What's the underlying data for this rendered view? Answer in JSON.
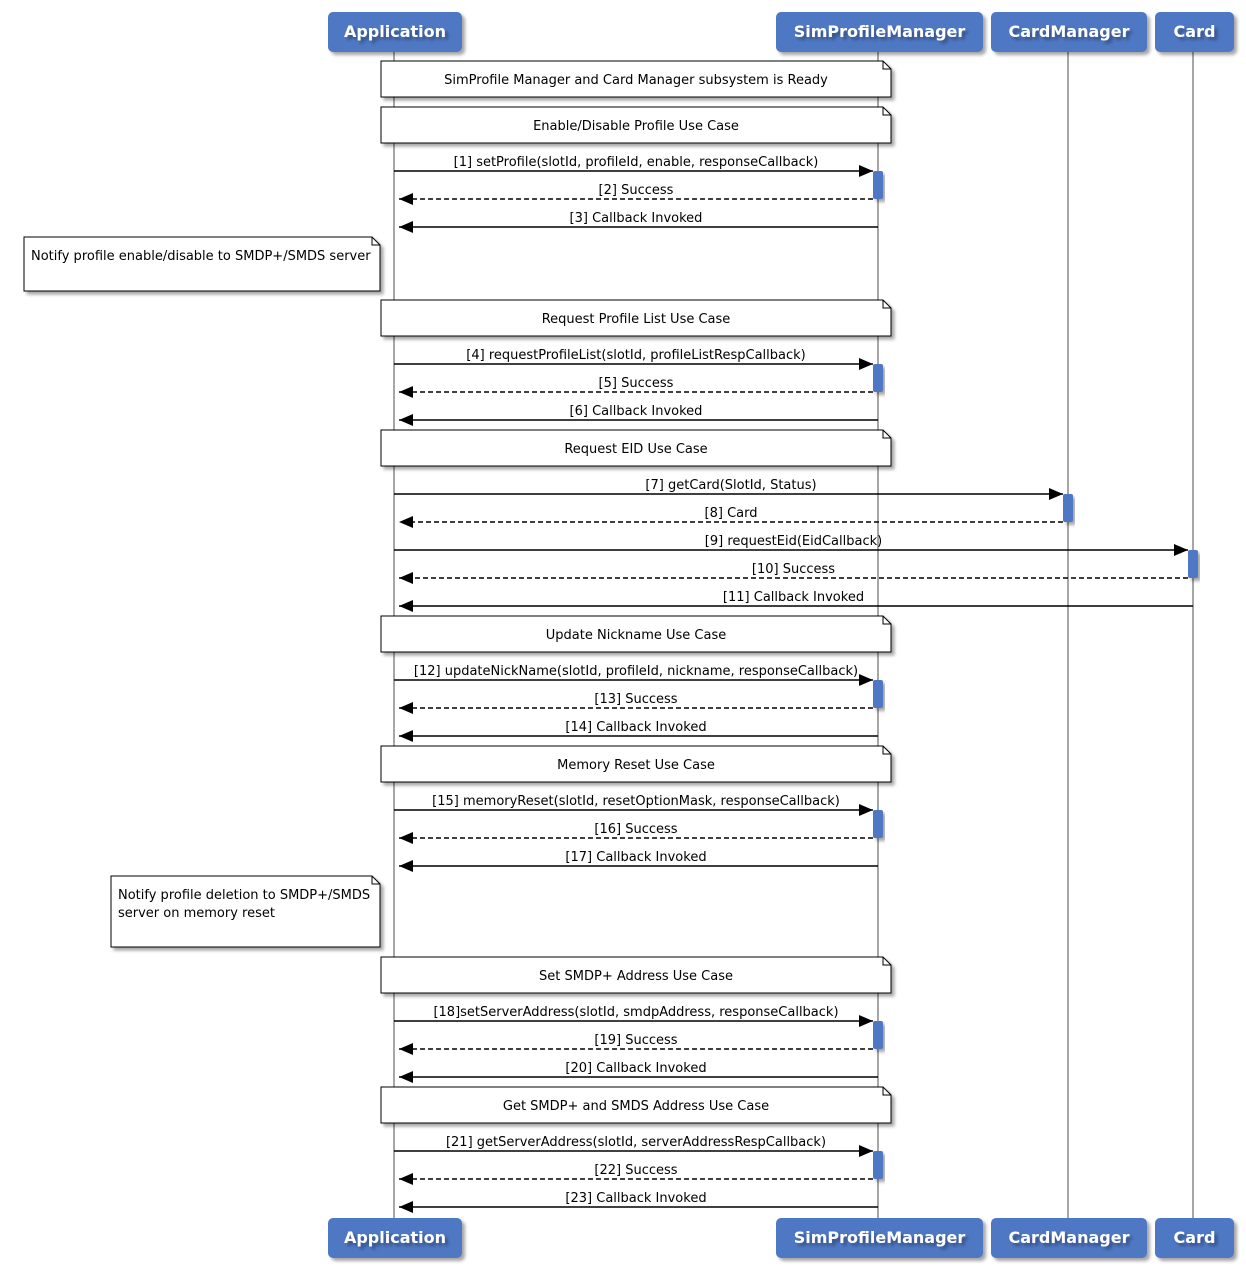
{
  "participants": [
    {
      "id": "app",
      "label": "Application"
    },
    {
      "id": "spm",
      "label": "SimProfileManager"
    },
    {
      "id": "cm",
      "label": "CardManager"
    },
    {
      "id": "card",
      "label": "Card"
    }
  ],
  "colors": {
    "participant_fill": "#4f78c4",
    "activation_fill": "#4f78c4",
    "lifeline": "#888888",
    "note_fill": "#ffffff"
  },
  "events": [
    {
      "type": "note",
      "text": "SimProfile Manager and Card Manager subsystem is Ready"
    },
    {
      "type": "note",
      "text": "Enable/Disable Profile Use Case"
    },
    {
      "type": "msg",
      "from": "app",
      "to": "spm",
      "label": "[1] setProfile(slotId, profileId, enable, responseCallback)"
    },
    {
      "type": "msg",
      "from": "spm",
      "to": "app",
      "label": "[2] Success",
      "dashed": true
    },
    {
      "type": "msg",
      "from": "spm",
      "to": "app",
      "label": "[3] Callback Invoked"
    },
    {
      "type": "leftnote",
      "lines": [
        "Notify profile enable/disable to SMDP+/SMDS server"
      ]
    },
    {
      "type": "note",
      "text": "Request Profile List Use Case"
    },
    {
      "type": "msg",
      "from": "app",
      "to": "spm",
      "label": "[4] requestProfileList(slotId, profileListRespCallback)"
    },
    {
      "type": "msg",
      "from": "spm",
      "to": "app",
      "label": "[5] Success",
      "dashed": true
    },
    {
      "type": "msg",
      "from": "spm",
      "to": "app",
      "label": "[6] Callback Invoked"
    },
    {
      "type": "note",
      "text": "Request EID Use Case"
    },
    {
      "type": "msg",
      "from": "app",
      "to": "cm",
      "label": "[7] getCard(SlotId, Status)"
    },
    {
      "type": "msg",
      "from": "cm",
      "to": "app",
      "label": "[8] Card",
      "dashed": true
    },
    {
      "type": "msg",
      "from": "app",
      "to": "card",
      "label": "[9] requestEid(EidCallback)"
    },
    {
      "type": "msg",
      "from": "card",
      "to": "app",
      "label": "[10] Success",
      "dashed": true
    },
    {
      "type": "msg",
      "from": "card",
      "to": "app",
      "label": "[11] Callback Invoked"
    },
    {
      "type": "note",
      "text": "Update Nickname Use Case"
    },
    {
      "type": "msg",
      "from": "app",
      "to": "spm",
      "label": "[12] updateNickName(slotId, profileId, nickname, responseCallback)"
    },
    {
      "type": "msg",
      "from": "spm",
      "to": "app",
      "label": "[13] Success",
      "dashed": true
    },
    {
      "type": "msg",
      "from": "spm",
      "to": "app",
      "label": "[14] Callback Invoked"
    },
    {
      "type": "note",
      "text": "Memory Reset Use Case"
    },
    {
      "type": "msg",
      "from": "app",
      "to": "spm",
      "label": "[15] memoryReset(slotId, resetOptionMask, responseCallback)"
    },
    {
      "type": "msg",
      "from": "spm",
      "to": "app",
      "label": "[16] Success",
      "dashed": true
    },
    {
      "type": "msg",
      "from": "spm",
      "to": "app",
      "label": "[17] Callback Invoked"
    },
    {
      "type": "leftnote",
      "lines": [
        "Notify profile deletion to SMDP+/SMDS",
        "server on memory reset"
      ]
    },
    {
      "type": "note",
      "text": "Set SMDP+ Address Use Case"
    },
    {
      "type": "msg",
      "from": "app",
      "to": "spm",
      "label": "[18]setServerAddress(slotId, smdpAddress, responseCallback)"
    },
    {
      "type": "msg",
      "from": "spm",
      "to": "app",
      "label": "[19] Success",
      "dashed": true
    },
    {
      "type": "msg",
      "from": "spm",
      "to": "app",
      "label": "[20] Callback Invoked"
    },
    {
      "type": "note",
      "text": "Get SMDP+ and SMDS Address Use Case"
    },
    {
      "type": "msg",
      "from": "app",
      "to": "spm",
      "label": "[21] getServerAddress(slotId, serverAddressRespCallback)"
    },
    {
      "type": "msg",
      "from": "spm",
      "to": "app",
      "label": "[22] Success",
      "dashed": true
    },
    {
      "type": "msg",
      "from": "spm",
      "to": "app",
      "label": "[23] Callback Invoked"
    }
  ]
}
